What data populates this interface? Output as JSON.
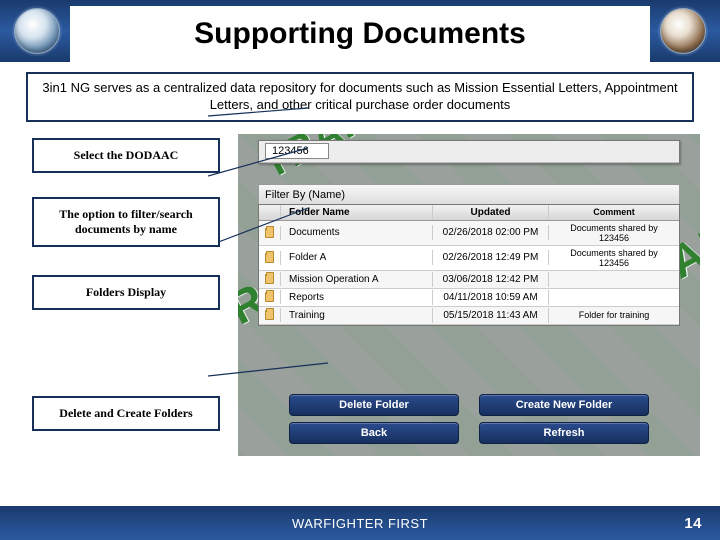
{
  "header": {
    "title": "Supporting Documents"
  },
  "banner": "3in1 NG serves as a centralized data repository for documents such as Mission Essential Letters, Appointment Letters, and other critical purchase order documents",
  "callouts": {
    "dodaac": "Select the DODAAC",
    "filter": "The option to filter/search documents by name",
    "folders": "Folders Display",
    "actions": "Delete and Create Folders"
  },
  "app": {
    "dodaac_value": "123456",
    "filter_label": "Filter By (Name)",
    "table": {
      "headers": {
        "name": "Folder Name",
        "updated": "Updated",
        "comment": "Comment"
      },
      "rows": [
        {
          "name": "Documents",
          "updated": "02/26/2018 02:00 PM",
          "comment": "Documents shared by 123456"
        },
        {
          "name": "Folder A",
          "updated": "02/26/2018 12:49 PM",
          "comment": "Documents shared by 123456"
        },
        {
          "name": "Mission Operation A",
          "updated": "03/06/2018 12:42 PM",
          "comment": ""
        },
        {
          "name": "Reports",
          "updated": "04/11/2018 10:59 AM",
          "comment": ""
        },
        {
          "name": "Training",
          "updated": "05/15/2018 11:43 AM",
          "comment": "Folder for training"
        }
      ]
    },
    "buttons": {
      "delete": "Delete Folder",
      "create": "Create New Folder",
      "back": "Back",
      "refresh": "Refresh"
    }
  },
  "footer": {
    "text": "WARFIGHTER FIRST",
    "page": "14"
  }
}
